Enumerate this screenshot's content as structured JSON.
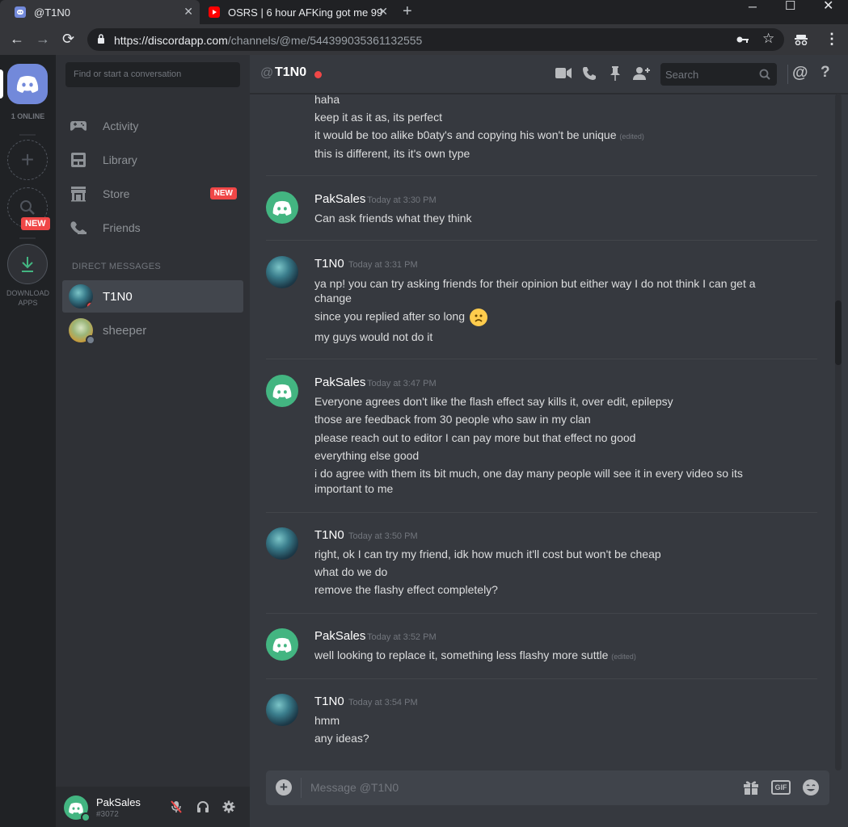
{
  "browser": {
    "tabs": [
      {
        "title": "@T1N0",
        "icon": "discord-icon",
        "active": true
      },
      {
        "title": "OSRS | 6 hour AFKing got me 99",
        "icon": "youtube-icon",
        "active": false
      }
    ],
    "url_host": "https://discordapp.com",
    "url_path": "/channels/@me/544399035361132555"
  },
  "guilds": {
    "online_label": "1 ONLINE",
    "new_badge": "NEW",
    "download_label_1": "DOWNLOAD",
    "download_label_2": "APPS"
  },
  "sidebar": {
    "search_placeholder": "Find or start a conversation",
    "nav": [
      {
        "label": "Activity",
        "icon": "controller-icon"
      },
      {
        "label": "Library",
        "icon": "library-icon"
      },
      {
        "label": "Store",
        "icon": "store-icon",
        "badge": "NEW"
      },
      {
        "label": "Friends",
        "icon": "friends-icon"
      }
    ],
    "dm_heading": "DIRECT MESSAGES",
    "dms": [
      {
        "name": "T1N0",
        "status": "dnd",
        "selected": true
      },
      {
        "name": "sheeper",
        "status": "offline",
        "selected": false
      }
    ]
  },
  "user": {
    "name": "PakSales",
    "tag": "#3072"
  },
  "channel": {
    "at": "@",
    "name": "T1N0",
    "search_placeholder": "Search"
  },
  "messages": {
    "g0": {
      "lines": [
        "haha",
        "keep it as it as, its perfect",
        "it would be too alike b0aty's and copying his won't be unique",
        "this is different, its it's own type"
      ],
      "edited": "(edited)"
    },
    "g1": {
      "author": "PakSales",
      "time": "Today at 3:30 PM",
      "lines": [
        "Can ask friends what they think"
      ]
    },
    "g2": {
      "author": "T1N0",
      "time": "Today at 3:31 PM",
      "lines": [
        "ya np! you can try asking friends for their opinion but either way I do not think I can get a",
        "change",
        "since you replied after so long",
        "my guys would not do it"
      ]
    },
    "g3": {
      "author": "PakSales",
      "time": "Today at 3:47 PM",
      "lines": [
        "Everyone agrees don't like the flash effect say kills it, over edit, epilepsy",
        "those are feedback from 30 people who saw in my clan",
        "please reach out to editor I can pay more but that effect no good",
        "everything else good",
        "i do agree with them its bit much, one day many people will see it in every video so its",
        "important to me"
      ]
    },
    "g4": {
      "author": "T1N0",
      "time": "Today at 3:50 PM",
      "lines": [
        "right, ok I can try my friend, idk how much it'll cost but won't be cheap",
        "what do we do",
        "remove the flashy effect completely?"
      ]
    },
    "g5": {
      "author": "PakSales",
      "time": "Today at 3:52 PM",
      "lines": [
        "well looking to replace it, something less flashy more suttle"
      ],
      "edited": "(edited)"
    },
    "g6": {
      "author": "T1N0",
      "time": "Today at 3:54 PM",
      "lines": [
        "hmm",
        "any ideas?"
      ]
    }
  },
  "composer": {
    "placeholder": "Message @T1N0",
    "gif_label": "GIF"
  }
}
